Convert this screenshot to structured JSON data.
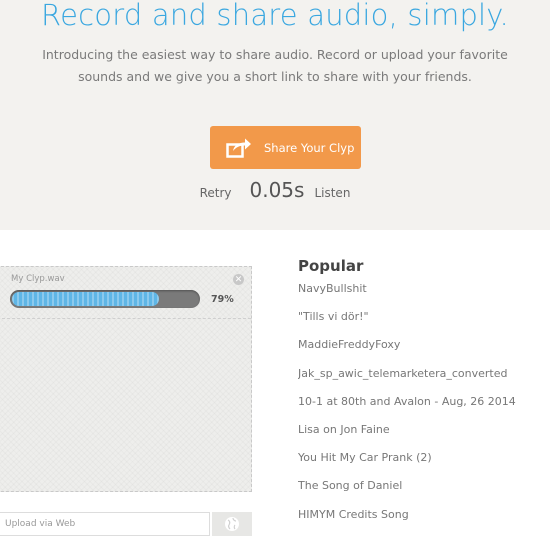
{
  "hero": {
    "title": "Record and share audio, simply.",
    "subtitle": "Introducing the easiest way to share audio. Record or upload your favorite sounds and we give you a short link to share with your friends.",
    "share_button_label": "Share Your Clyp",
    "retry_label": "Retry",
    "duration": "0.05s",
    "listen_label": "Listen"
  },
  "upload": {
    "file_name": "My Clyp.wav",
    "progress": 0.79,
    "progress_label": "79%",
    "close_icon": "close-icon",
    "url_placeholder": "Upload via Web",
    "globe_icon": "globe-icon"
  },
  "popular": {
    "title": "Popular",
    "items": [
      "NavyBullshit",
      "\"Tills vi dör!\"",
      "MaddieFreddyFoxy",
      "Jak_sp_awic_telemarketera_converted",
      "10-1 at 80th and Avalon - Aug, 26 2014",
      "Lisa on Jon Faine",
      "You Hit My Car Prank (2)",
      "The Song of Daniel",
      "HIMYM Credits Song"
    ]
  },
  "colors": {
    "accent_blue": "#3aa7e0",
    "button_orange": "#f2994a",
    "progress_blue": "#5fb6e6"
  }
}
